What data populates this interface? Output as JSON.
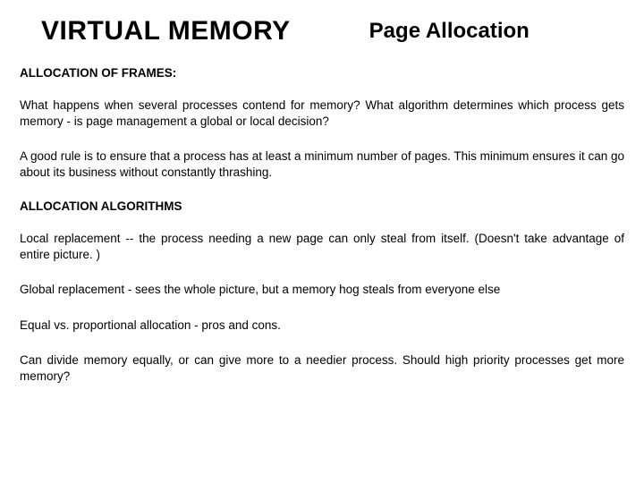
{
  "header": {
    "main_title": "VIRTUAL MEMORY",
    "sub_title": "Page Allocation"
  },
  "sections": {
    "heading1": "ALLOCATION OF FRAMES:",
    "para1": "What happens when several processes contend for memory? What algorithm determines which process gets memory - is page management a global or local decision?",
    "para2": "A good rule is to ensure that a process has at least a minimum number of pages. This minimum ensures it can go about its business without constantly thrashing.",
    "heading2": "ALLOCATION ALGORITHMS",
    "para3": "Local replacement -- the process needing a new page can only steal from itself. (Doesn't take advantage of entire picture. )",
    "para4": "Global replacement - sees the whole picture, but a memory hog steals from everyone else",
    "para5": "Equal vs. proportional allocation - pros and cons.",
    "para6": "Can divide memory equally, or can give more to a needier process. Should high priority processes get more memory?"
  }
}
